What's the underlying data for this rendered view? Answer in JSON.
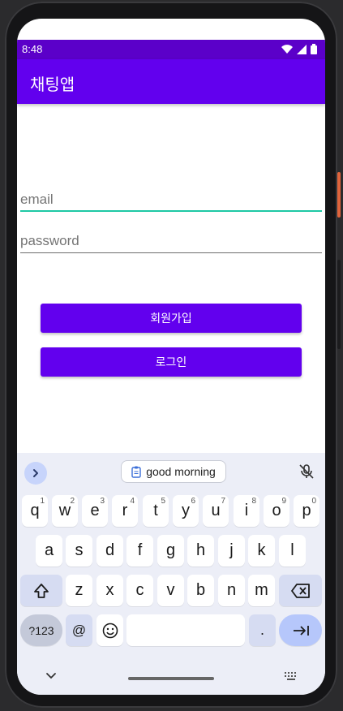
{
  "status_bar": {
    "time": "8:48",
    "icons": [
      "wifi-icon",
      "signal-icon",
      "battery-icon"
    ]
  },
  "app": {
    "title": "채팅앱"
  },
  "form": {
    "email_placeholder": "email",
    "email_value": "",
    "password_placeholder": "password",
    "password_value": "",
    "signup_label": "회원가입",
    "login_label": "로그인"
  },
  "keyboard": {
    "suggestion": "good morning",
    "row1": [
      {
        "key": "q",
        "hint": "1"
      },
      {
        "key": "w",
        "hint": "2"
      },
      {
        "key": "e",
        "hint": "3"
      },
      {
        "key": "r",
        "hint": "4"
      },
      {
        "key": "t",
        "hint": "5"
      },
      {
        "key": "y",
        "hint": "6"
      },
      {
        "key": "u",
        "hint": "7"
      },
      {
        "key": "i",
        "hint": "8"
      },
      {
        "key": "o",
        "hint": "9"
      },
      {
        "key": "p",
        "hint": "0"
      }
    ],
    "row2": [
      "a",
      "s",
      "d",
      "f",
      "g",
      "h",
      "j",
      "k",
      "l"
    ],
    "row3": [
      "z",
      "x",
      "c",
      "v",
      "b",
      "n",
      "m"
    ],
    "symbols_label": "?123",
    "at_label": "@",
    "period_label": "."
  },
  "colors": {
    "primary": "#6200ee",
    "status_bar": "#5b00c9",
    "email_underline": "#1ec8a5",
    "keyboard_bg": "#eceef7",
    "enter_key": "#b6c7fb"
  }
}
